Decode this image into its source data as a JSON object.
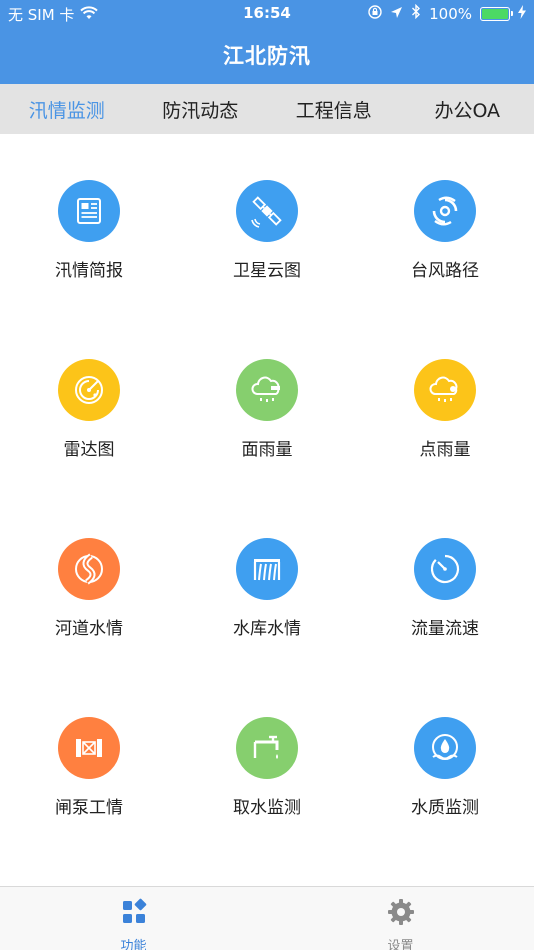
{
  "status_bar": {
    "carrier": "无 SIM 卡",
    "time": "16:54",
    "battery": "100%"
  },
  "header": {
    "title": "江北防汛"
  },
  "tabs": [
    {
      "label": "汛情监测",
      "active": true
    },
    {
      "label": "防汛动态",
      "active": false
    },
    {
      "label": "工程信息",
      "active": false
    },
    {
      "label": "办公OA",
      "active": false
    }
  ],
  "grid": [
    {
      "label": "汛情简报",
      "icon": "newspaper-icon",
      "color": "#3f9ff0"
    },
    {
      "label": "卫星云图",
      "icon": "satellite-icon",
      "color": "#3f9ff0"
    },
    {
      "label": "台风路径",
      "icon": "typhoon-icon",
      "color": "#3f9ff0"
    },
    {
      "label": "雷达图",
      "icon": "radar-icon",
      "color": "#fcc419"
    },
    {
      "label": "面雨量",
      "icon": "cloud-rain-icon",
      "color": "#86cf6e"
    },
    {
      "label": "点雨量",
      "icon": "cloud-rain-point-icon",
      "color": "#fcc419"
    },
    {
      "label": "河道水情",
      "icon": "river-icon",
      "color": "#ff8040"
    },
    {
      "label": "水库水情",
      "icon": "reservoir-dam-icon",
      "color": "#3f9ff0"
    },
    {
      "label": "流量流速",
      "icon": "gauge-icon",
      "color": "#3f9ff0"
    },
    {
      "label": "闸泵工情",
      "icon": "sluice-gate-icon",
      "color": "#ff8040"
    },
    {
      "label": "取水监测",
      "icon": "water-tap-icon",
      "color": "#86cf6e"
    },
    {
      "label": "水质监测",
      "icon": "water-drop-icon",
      "color": "#3f9ff0"
    }
  ],
  "bottom_nav": [
    {
      "label": "功能",
      "icon": "grid-apps-icon",
      "active": true
    },
    {
      "label": "设置",
      "icon": "gear-icon",
      "active": false
    }
  ],
  "colors": {
    "primary": "#4a94e4",
    "tab_bg": "#e3e3e3",
    "nav_active": "#3b82d9",
    "nav_inactive": "#8a8a8a"
  }
}
